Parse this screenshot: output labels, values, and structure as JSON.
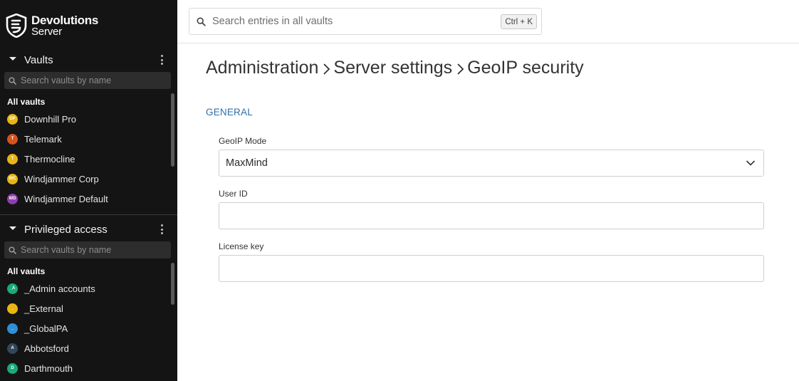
{
  "brand": {
    "line1": "Devolutions",
    "line2": "Server"
  },
  "sidebar": {
    "vaults": {
      "title": "Vaults",
      "search_placeholder": "Search vaults by name",
      "all_label": "All vaults",
      "items": [
        {
          "initials": "DP",
          "name": "Downhill Pro",
          "color": "#e8b514"
        },
        {
          "initials": "T",
          "name": "Telemark",
          "color": "#d4541c"
        },
        {
          "initials": "T",
          "name": "Thermocline",
          "color": "#e8b514"
        },
        {
          "initials": "WC",
          "name": "Windjammer Corp",
          "color": "#e8b514"
        },
        {
          "initials": "WD",
          "name": "Windjammer Default",
          "color": "#8e3fae"
        }
      ]
    },
    "privileged": {
      "title": "Privileged access",
      "search_placeholder": "Search vaults by name",
      "all_label": "All vaults",
      "items": [
        {
          "initials": "_A",
          "name": "_Admin accounts",
          "color": "#19a97b"
        },
        {
          "initials": "_",
          "name": "_External",
          "color": "#e8b514"
        },
        {
          "initials": "_",
          "name": "_GlobalPA",
          "color": "#2e8fd6"
        },
        {
          "initials": "A",
          "name": "Abbotsford",
          "color": "#33475b"
        },
        {
          "initials": "D",
          "name": "Darthmouth",
          "color": "#19a97b"
        }
      ]
    }
  },
  "header": {
    "search_placeholder": "Search entries in all vaults",
    "shortcut": "Ctrl + K"
  },
  "breadcrumb": [
    "Administration",
    "Server settings",
    "GeoIP security"
  ],
  "form": {
    "section": "GENERAL",
    "geoip_mode": {
      "label": "GeoIP Mode",
      "value": "MaxMind"
    },
    "user_id": {
      "label": "User ID",
      "value": ""
    },
    "license_key": {
      "label": "License key",
      "value": ""
    }
  }
}
